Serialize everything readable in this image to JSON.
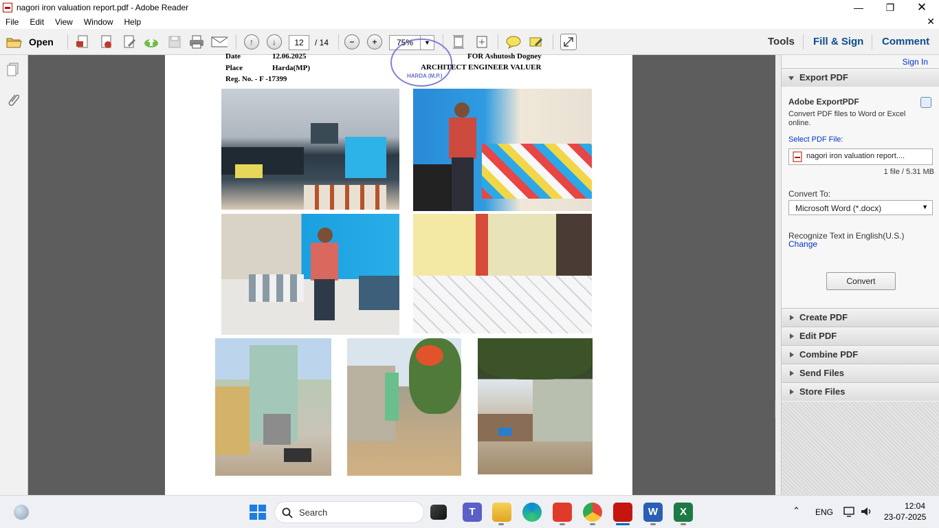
{
  "window": {
    "title": "nagori iron valuation report.pdf - Adobe Reader"
  },
  "menu": [
    "File",
    "Edit",
    "View",
    "Window",
    "Help"
  ],
  "toolbar": {
    "open_label": "Open",
    "page_current": "12",
    "page_total": "/ 14",
    "zoom": "75%",
    "tabs": [
      "Tools",
      "Fill & Sign",
      "Comment"
    ]
  },
  "document": {
    "header": {
      "date_label": "Date",
      "date_value": "12.06.2025",
      "place_label": "Place",
      "place_value": "Harda(MP)",
      "reg_no": "Reg. No. - F -17399",
      "for_line": "FOR  Ashutosh Dogney",
      "role_line": "ARCHITECT   ENGINEER   VALUER",
      "stamp_text": "HARDA (M.P.)"
    }
  },
  "panel": {
    "sign_in": "Sign In",
    "export_title": "Export PDF",
    "service_name": "Adobe ExportPDF",
    "description": "Convert PDF files to Word or Excel online.",
    "select_label": "Select PDF File:",
    "file_name": "nagori iron valuation report....",
    "file_info": "1 file / 5.31 MB",
    "convert_to_label": "Convert To:",
    "format": "Microsoft Word (*.docx)",
    "recognize_text": "Recognize Text in English(U.S.)",
    "change_link": "Change",
    "convert_button": "Convert",
    "sections": [
      "Create PDF",
      "Edit PDF",
      "Combine PDF",
      "Send Files",
      "Store Files"
    ]
  },
  "taskbar": {
    "search_placeholder": "Search",
    "language": "ENG",
    "time": "12:04",
    "date": "23-07-2025"
  },
  "colors": {
    "accent": "#0b4d8c",
    "adobe_red": "#b30b00",
    "link": "#0033cc"
  }
}
